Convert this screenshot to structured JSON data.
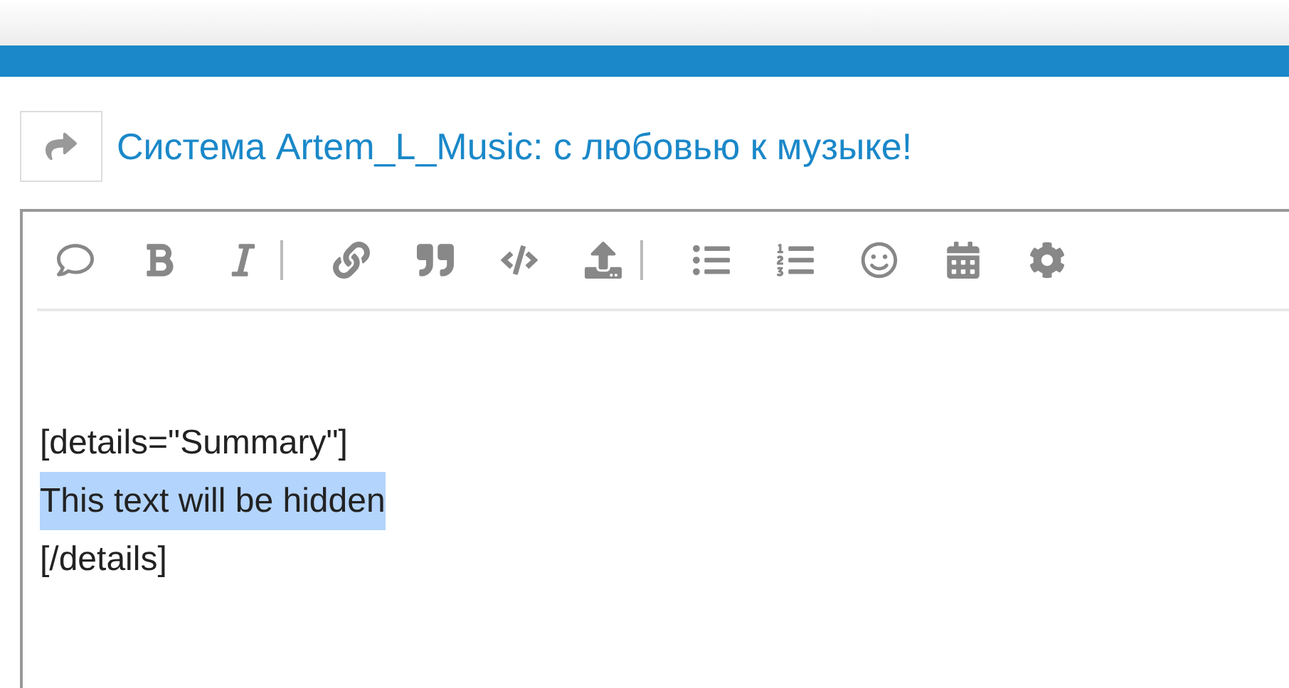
{
  "topic": {
    "title": "Система Artem_L_Music: с любовью к музыке!"
  },
  "editor": {
    "lines": [
      {
        "text": "[details=\"Summary\"]",
        "selected": false
      },
      {
        "text": "This text will be hidden",
        "selected": true
      },
      {
        "text": "[/details]",
        "selected": false
      }
    ]
  }
}
